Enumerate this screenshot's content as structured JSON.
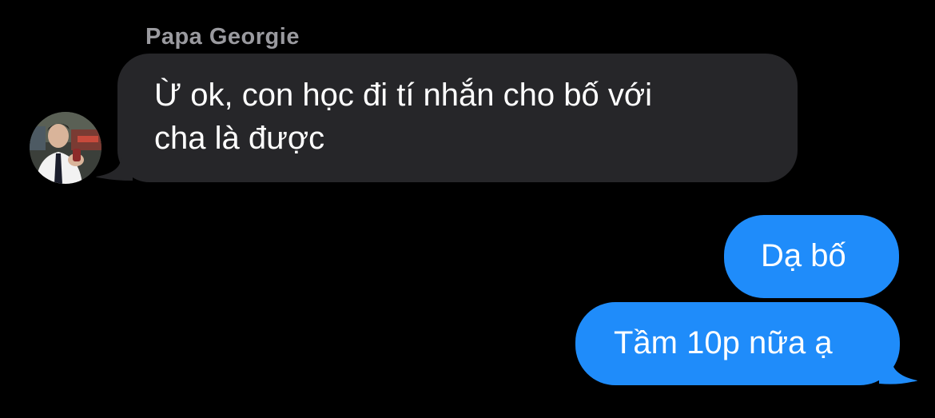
{
  "conversation": {
    "sender_name": "Papa Georgie",
    "messages": [
      {
        "direction": "incoming",
        "text": "Ừ ok, con học đi tí nhắn cho bố với\ncha là được"
      },
      {
        "direction": "outgoing",
        "text": "Dạ bố"
      },
      {
        "direction": "outgoing",
        "text": "Tầm 10p nữa ạ"
      }
    ]
  },
  "colors": {
    "background": "#000000",
    "incoming_bubble": "#262629",
    "outgoing_bubble": "#1f8cfa",
    "sender_name": "#9a9a9f",
    "text": "#ffffff"
  },
  "icons": {
    "avatar": "sender-avatar-photo"
  }
}
